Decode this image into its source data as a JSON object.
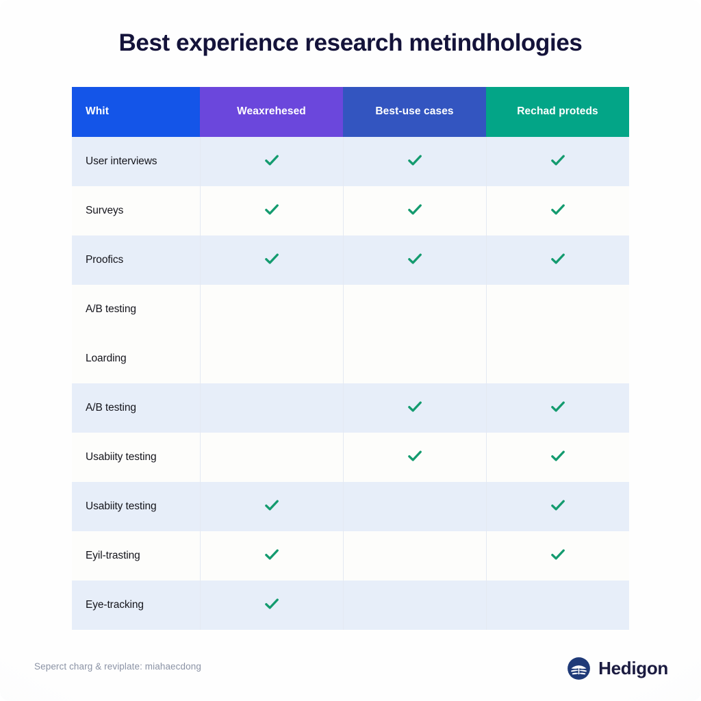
{
  "page": {
    "title": "Best experience research metindhologies",
    "background_color": "#fefefe",
    "title_color": "#14133a"
  },
  "table": {
    "headers": [
      {
        "label": "Whit",
        "color": "#1455e8",
        "align": "left"
      },
      {
        "label": "Weaxrehesed",
        "color": "#6b47dc",
        "align": "center"
      },
      {
        "label": "Best-use cases",
        "color": "#3355c0",
        "align": "center"
      },
      {
        "label": "Rechad proteds",
        "color": "#03a587",
        "align": "center"
      }
    ],
    "check_icon": "check-icon",
    "check_color": "#149b6f",
    "row_tint_color": "#e7eef9",
    "row_plain_color": "#fdfdfb",
    "rows": [
      {
        "method": "User interviews",
        "band": "tint",
        "marks": [
          true,
          true,
          true
        ]
      },
      {
        "method": "Surveys",
        "band": "plain",
        "marks": [
          true,
          true,
          true
        ]
      },
      {
        "method": "Proofics",
        "band": "tint",
        "marks": [
          true,
          true,
          true
        ]
      },
      {
        "method": "A/B testing",
        "band": "plain",
        "marks": [
          false,
          false,
          false
        ]
      },
      {
        "method": "Loarding",
        "band": "plain",
        "marks": [
          false,
          false,
          false
        ]
      },
      {
        "method": "A/B testing",
        "band": "tint",
        "marks": [
          false,
          true,
          true
        ]
      },
      {
        "method": "Usabiity testing",
        "band": "plain",
        "marks": [
          false,
          true,
          true
        ]
      },
      {
        "method": "Usabiity testing",
        "band": "tint",
        "marks": [
          true,
          false,
          true
        ]
      },
      {
        "method": "Eyil-trasting",
        "band": "plain",
        "marks": [
          true,
          false,
          true
        ]
      },
      {
        "method": "Eye-tracking",
        "band": "tint",
        "marks": [
          true,
          false,
          false
        ]
      }
    ]
  },
  "footer": {
    "note": "Seperct charg & reviplate: miahaecdong",
    "note_color": "#8b93a5",
    "brand_name": "Hedigon",
    "brand_icon": "wave-circle-logo-icon",
    "brand_color": "#1b1b40"
  }
}
